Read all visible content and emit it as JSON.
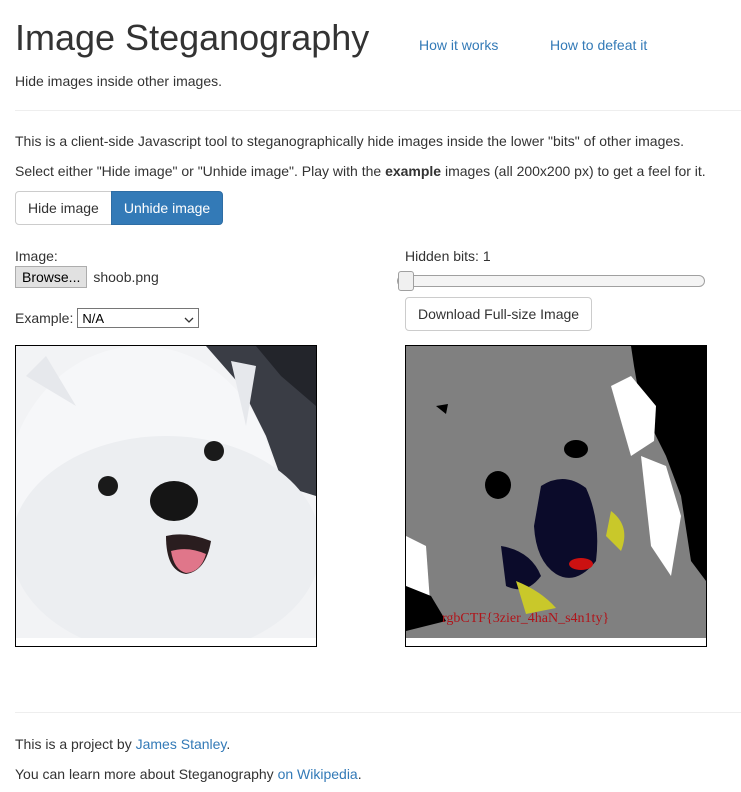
{
  "header": {
    "title": "Image Steganography",
    "nav": [
      {
        "label": "How it works"
      },
      {
        "label": "How to defeat it"
      }
    ],
    "tagline": "Hide images inside other images."
  },
  "intro": {
    "line1": "This is a client-side Javascript tool to steganographically hide images inside the lower \"bits\" of other images.",
    "line2_before": "Select either \"Hide image\" or \"Unhide image\". Play with the ",
    "line2_bold": "example",
    "line2_after": " images (all 200x200 px) to get a feel for it."
  },
  "mode": {
    "hide_label": "Hide image",
    "unhide_label": "Unhide image",
    "active": "unhide"
  },
  "left_panel": {
    "image_label": "Image:",
    "browse_label": "Browse...",
    "filename": "shoob.png",
    "example_label": "Example:",
    "example_selected": "N/A"
  },
  "right_panel": {
    "hidden_bits_label": "Hidden bits: 1",
    "hidden_bits_value": 1,
    "download_label": "Download Full-size Image",
    "revealed_text": "rgbCTF{3zier_4haN_s4n1ty}"
  },
  "colors": {
    "link": "#337ab7",
    "primary": "#337ab7",
    "revealed_text": "#b0141a"
  },
  "footer": {
    "line1_before": "This is a project by ",
    "line1_link": "James Stanley",
    "line1_after": ".",
    "line2_before": "You can learn more about Steganography ",
    "line2_link": "on Wikipedia",
    "line2_after": "."
  }
}
